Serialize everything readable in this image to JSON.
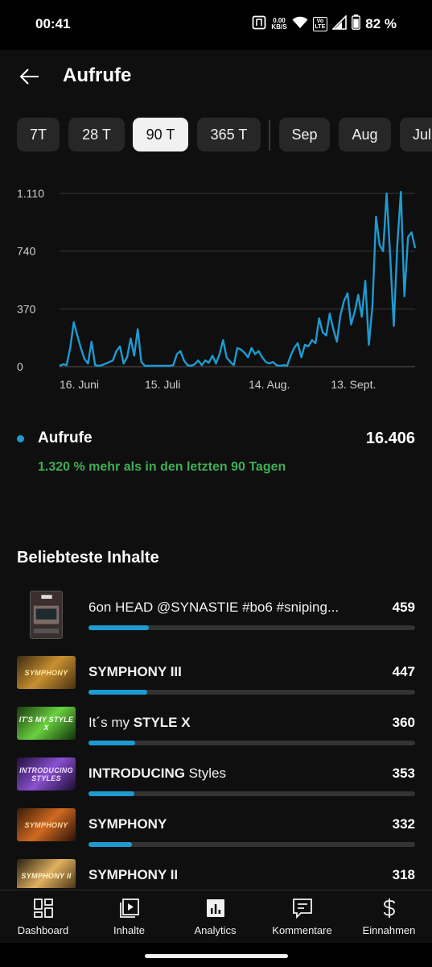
{
  "status_bar": {
    "time": "00:41",
    "speed_value": "0.00",
    "speed_unit": "KB/S",
    "volte_top": "Vo",
    "volte_bottom": "LTE",
    "battery_percent": "82 %",
    "icons": [
      "nfc-icon",
      "wifi-icon",
      "volte-icon",
      "signal-icon",
      "battery-icon"
    ]
  },
  "header": {
    "back_icon": "arrow-left-icon",
    "title": "Aufrufe"
  },
  "period_chips": [
    {
      "label": "7T",
      "active": false
    },
    {
      "label": "28 T",
      "active": false
    },
    {
      "label": "90 T",
      "active": true
    },
    {
      "label": "365 T",
      "active": false
    },
    {
      "label": "Sep",
      "active": false
    },
    {
      "label": "Aug",
      "active": false
    },
    {
      "label": "Jul",
      "active": false
    }
  ],
  "chart_data": {
    "type": "line",
    "title": "",
    "xlabel": "",
    "ylabel": "",
    "ylim": [
      0,
      1110
    ],
    "y_ticks": [
      "0",
      "370",
      "740",
      "1.110"
    ],
    "y_tick_values": [
      0,
      370,
      740,
      1110
    ],
    "x_ticks": [
      "16. Juni",
      "15. Juli",
      "14. Aug.",
      "13. Sept."
    ],
    "x_tick_days": [
      0,
      29,
      59,
      89
    ],
    "x_start_label": "16. Juni",
    "grid": true,
    "color": "#1d9bd1",
    "series": [
      {
        "name": "Aufrufe",
        "values": [
          5,
          15,
          10,
          120,
          285,
          200,
          120,
          50,
          20,
          160,
          10,
          5,
          10,
          20,
          30,
          40,
          100,
          130,
          20,
          60,
          180,
          70,
          240,
          30,
          5,
          5,
          5,
          5,
          5,
          5,
          5,
          5,
          10,
          80,
          100,
          40,
          10,
          5,
          15,
          40,
          10,
          40,
          25,
          70,
          20,
          80,
          170,
          60,
          30,
          10,
          120,
          110,
          90,
          60,
          120,
          80,
          100,
          60,
          30,
          20,
          30,
          10,
          5,
          10,
          5,
          70,
          120,
          150,
          60,
          140,
          130,
          170,
          150,
          310,
          220,
          200,
          340,
          240,
          160,
          330,
          420,
          470,
          270,
          350,
          460,
          320,
          550,
          140,
          390,
          960,
          780,
          740,
          1110,
          700,
          260,
          780,
          1120,
          450,
          830,
          860,
          760
        ]
      }
    ]
  },
  "summary": {
    "metric_label": "Aufrufe",
    "metric_value": "16.406",
    "comparison": "1.320 % mehr als in den letzten 90 Tagen",
    "accent": "#1d9bd1",
    "positive_color": "#3fae57"
  },
  "section_title": "Beliebteste Inhalte",
  "top_content": [
    {
      "title_plain": "6on HEAD @SYNASTIE #bo6 #sniping...",
      "title_bold": "",
      "title_rest": "",
      "value": "459",
      "views": 459,
      "thumb_text": "",
      "thumb_style": "vertical"
    },
    {
      "title_plain": "",
      "title_bold": "SYMPHONY III",
      "title_rest": "",
      "value": "447",
      "views": 447,
      "thumb_text": "SYMPHONY",
      "thumb_style": "gold"
    },
    {
      "title_plain": "It´s my ",
      "title_bold": "STYLE X",
      "title_rest": "",
      "value": "360",
      "views": 360,
      "thumb_text": "IT'S MY STYLE X",
      "thumb_style": "green"
    },
    {
      "title_plain": "",
      "title_bold": "INTRODUCING",
      "title_rest": " Styles",
      "value": "353",
      "views": 353,
      "thumb_text": "INTRODUCING STYLES",
      "thumb_style": "purple"
    },
    {
      "title_plain": "",
      "title_bold": "SYMPHONY",
      "title_rest": "",
      "value": "332",
      "views": 332,
      "thumb_text": "SYMPHONY",
      "thumb_style": "orange"
    },
    {
      "title_plain": "",
      "title_bold": "SYMPHONY II",
      "title_rest": "",
      "value": "318",
      "views": 318,
      "thumb_text": "SYMPHONY II",
      "thumb_style": "gold2"
    }
  ],
  "bottom_nav": [
    {
      "label": "Dashboard",
      "icon": "dashboard-icon"
    },
    {
      "label": "Inhalte",
      "icon": "content-icon"
    },
    {
      "label": "Analytics",
      "icon": "analytics-icon"
    },
    {
      "label": "Kommentare",
      "icon": "comments-icon"
    },
    {
      "label": "Einnahmen",
      "icon": "earnings-icon"
    }
  ]
}
